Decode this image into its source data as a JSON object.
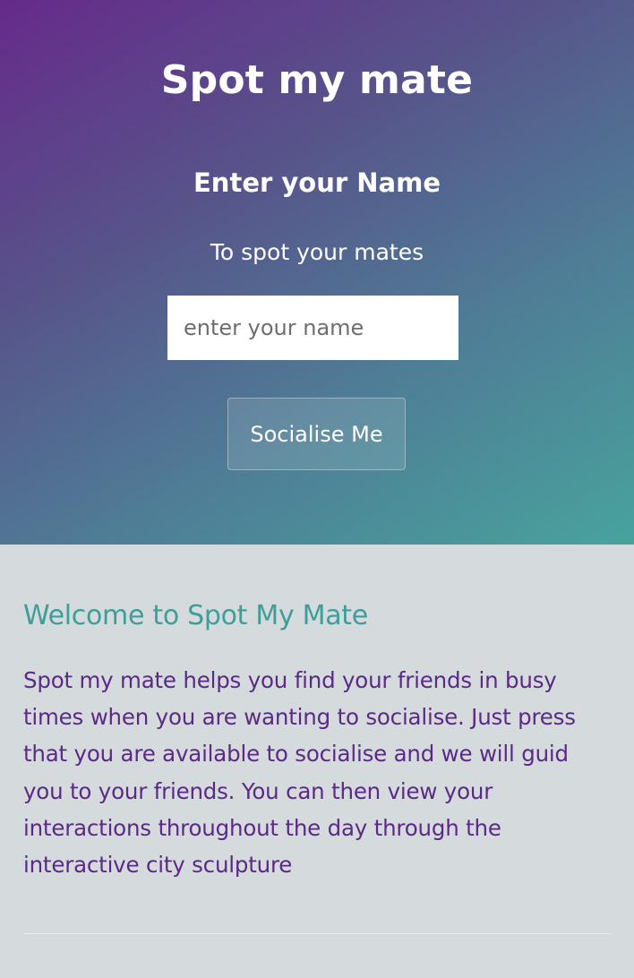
{
  "hero": {
    "app_title": "Spot my mate",
    "form_heading": "Enter your Name",
    "form_subtitle": "To spot your mates",
    "name_input": {
      "placeholder": "enter your name",
      "value": ""
    },
    "submit_button_label": "Socialise Me"
  },
  "info": {
    "welcome_heading": "Welcome to Spot My Mate",
    "welcome_text": "Spot my mate helps you find your friends in busy times when you are wanting to socialise. Just press that you are available to socialise and we will guid you to your friends. You can then view your interactions throughout the day through the interactive city sculpture"
  },
  "colors": {
    "gradient_start": "#662a8a",
    "gradient_end": "#48a39c",
    "info_background": "#d5dadd",
    "heading_teal": "#3f9d9a",
    "body_text_purple": "#5b2a86"
  }
}
